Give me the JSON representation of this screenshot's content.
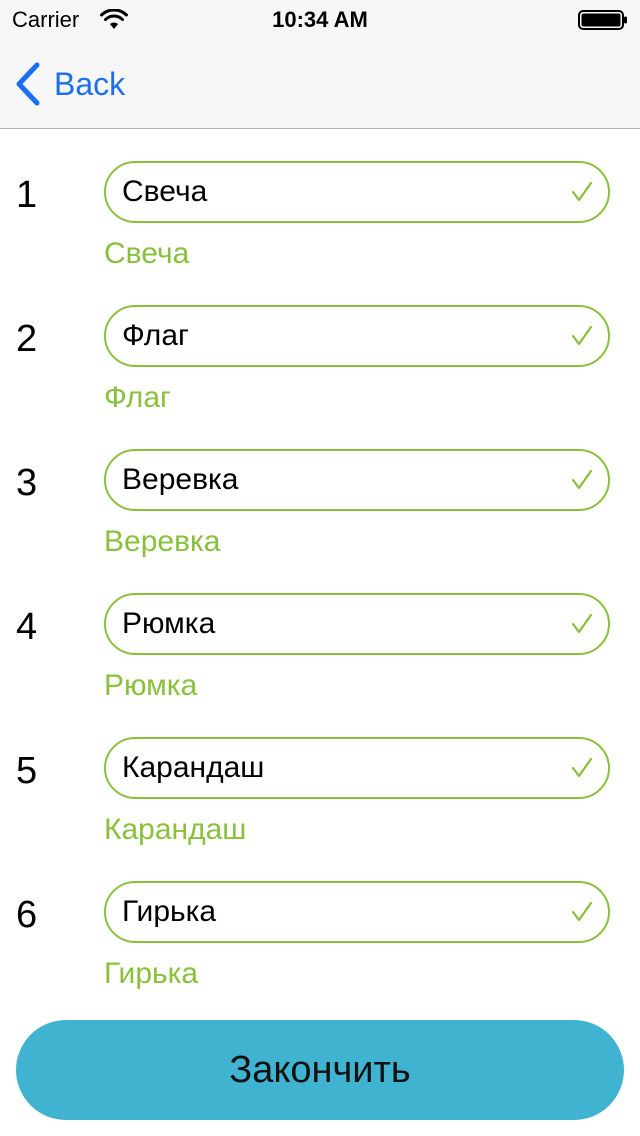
{
  "status_bar": {
    "carrier": "Carrier",
    "time": "10:34 AM",
    "icons": [
      "wifi-icon",
      "battery-icon"
    ]
  },
  "nav": {
    "back_label": "Back",
    "back_icon": "chevron-left-icon"
  },
  "colors": {
    "accent_green": "#8ac03b",
    "link_blue": "#1a6ff0",
    "button_blue": "#40b3d1"
  },
  "rows": [
    {
      "number": "1",
      "answer": "Свеча",
      "correct": "Свеча"
    },
    {
      "number": "2",
      "answer": "Флаг",
      "correct": "Флаг"
    },
    {
      "number": "3",
      "answer": "Веревка",
      "correct": "Веревка"
    },
    {
      "number": "4",
      "answer": "Рюмка",
      "correct": "Рюмка"
    },
    {
      "number": "5",
      "answer": "Карандаш",
      "correct": "Карандаш"
    },
    {
      "number": "6",
      "answer": "Гирька",
      "correct": "Гирька"
    }
  ],
  "finish_label": "Закончить"
}
